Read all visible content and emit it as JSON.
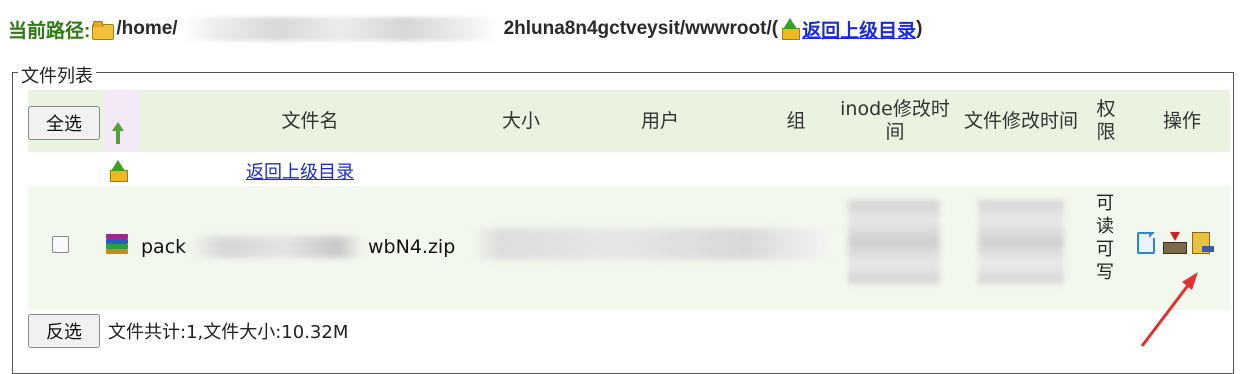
{
  "path": {
    "label": "当前路径:",
    "prefix": "/home/",
    "suffix": "2hluna8n4gctveysit/wwwroot/(",
    "up_link": "返回上级目录",
    "close": ")"
  },
  "file_list": {
    "legend": "文件列表",
    "select_all_label": "全选",
    "columns": [
      "文件名",
      "大小",
      "用户",
      "组",
      "inode修改时间",
      "文件修改时间",
      "权限",
      "操作"
    ],
    "back_link": "返回上级目录",
    "files": [
      {
        "name_start": "pack",
        "name_end": "wbN4.zip",
        "permissions": "可读可写",
        "checked": false,
        "actions": [
          "new-file-icon",
          "download-icon",
          "rename-icon"
        ]
      }
    ],
    "invert_label": "反选",
    "summary": "文件共计:1,文件大小:10.32M"
  },
  "colors": {
    "path_label": "#2e7a12",
    "link": "#1a2bd6",
    "header_bg": "#e9f3e0",
    "row_bg": "#f3f8ee",
    "annotation_arrow": "#e03030"
  }
}
